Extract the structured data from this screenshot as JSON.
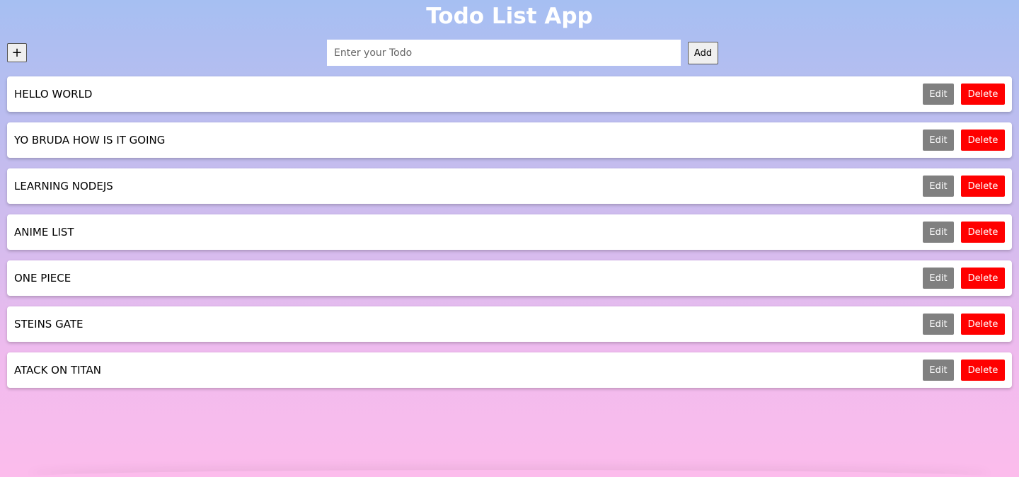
{
  "app": {
    "title": "Todo List App"
  },
  "toolbar": {
    "plus_label": "+",
    "input_value": "",
    "input_placeholder": "Enter your Todo",
    "add_label": "Add"
  },
  "todos": [
    {
      "text": "HELLO WORLD",
      "edit_label": "Edit",
      "delete_label": "Delete"
    },
    {
      "text": "YO BRUDA HOW IS IT GOING",
      "edit_label": "Edit",
      "delete_label": "Delete"
    },
    {
      "text": "LEARNING NODEJS",
      "edit_label": "Edit",
      "delete_label": "Delete"
    },
    {
      "text": "ANIME LIST",
      "edit_label": "Edit",
      "delete_label": "Delete"
    },
    {
      "text": "ONE PIECE",
      "edit_label": "Edit",
      "delete_label": "Delete"
    },
    {
      "text": "STEINS GATE",
      "edit_label": "Edit",
      "delete_label": "Delete"
    },
    {
      "text": "ATACK ON TITAN",
      "edit_label": "Edit",
      "delete_label": "Delete"
    }
  ],
  "colors": {
    "background_top": "#a6bff2",
    "background_bottom": "#fcbcec",
    "edit_button": "#808080",
    "delete_button": "#ff0000",
    "title_text": "#ffffff"
  }
}
